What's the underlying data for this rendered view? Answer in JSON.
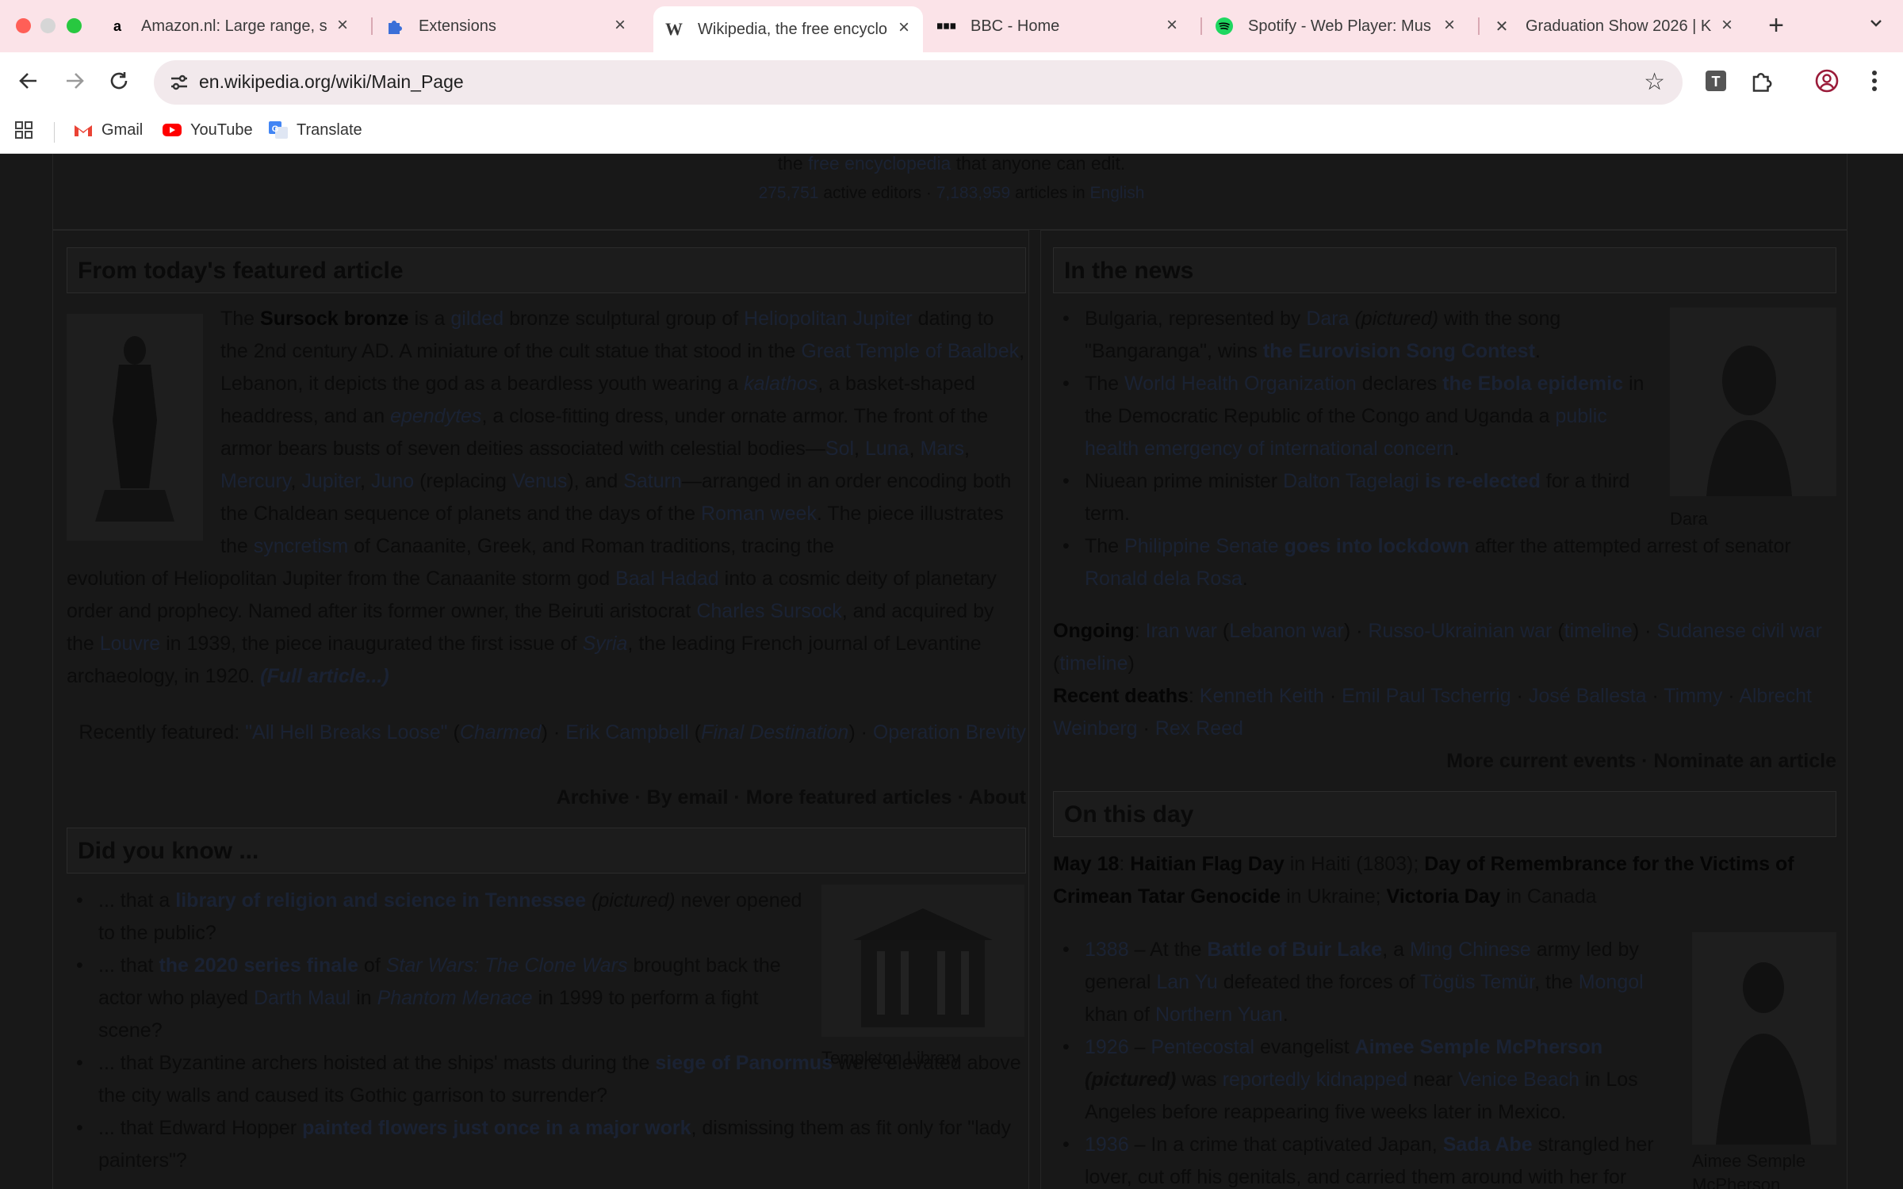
{
  "tabs": [
    {
      "title": "Amazon.nl: Large range, s",
      "icon": "amazon-icon",
      "active": false
    },
    {
      "title": "Extensions",
      "icon": "puzzle-icon",
      "active": false
    },
    {
      "title": "Wikipedia, the free encyclo",
      "icon": "wikipedia-icon",
      "active": true
    },
    {
      "title": "BBC - Home",
      "icon": "bbc-icon",
      "active": false
    },
    {
      "title": "Spotify - Web Player: Mus",
      "icon": "spotify-icon",
      "active": false
    },
    {
      "title": "Graduation Show 2026 | K",
      "icon": "kabk-icon",
      "active": false
    }
  ],
  "toolbar": {
    "url": "en.wikipedia.org/wiki/Main_Page"
  },
  "bookmarks": [
    "Gmail",
    "YouTube",
    "Translate"
  ],
  "banner": {
    "line1": {
      "pre": "the ",
      "link": "free encyclopedia",
      "post": " that anyone can edit."
    },
    "line2": {
      "editors": "275,751",
      "editors_label": " active editors · ",
      "articles": "7,183,959",
      "articles_label": " articles in ",
      "lang": "English"
    }
  },
  "featured": {
    "heading": "From today's featured article",
    "recently_prefix": "Recently featured: ",
    "recently_1": "\"All Hell Breaks Loose\"",
    "recently_1_show": "Charmed",
    "recently_2": "Erik Campbell",
    "recently_2_show": "Final Destination",
    "recently_3": "Operation Brevity",
    "links": "Archive · By email · More featured articles · About"
  },
  "dyk": {
    "heading": "Did you know ...",
    "caption": "Templeton Library"
  },
  "news": {
    "heading": "In the news",
    "caption": "Dara",
    "ongoing_label": "Ongoing",
    "recent_deaths_label": "Recent deaths",
    "more": "More current events · Nominate an article"
  },
  "otd": {
    "heading": "On this day",
    "caption": "Aimee Semple McPherson"
  }
}
